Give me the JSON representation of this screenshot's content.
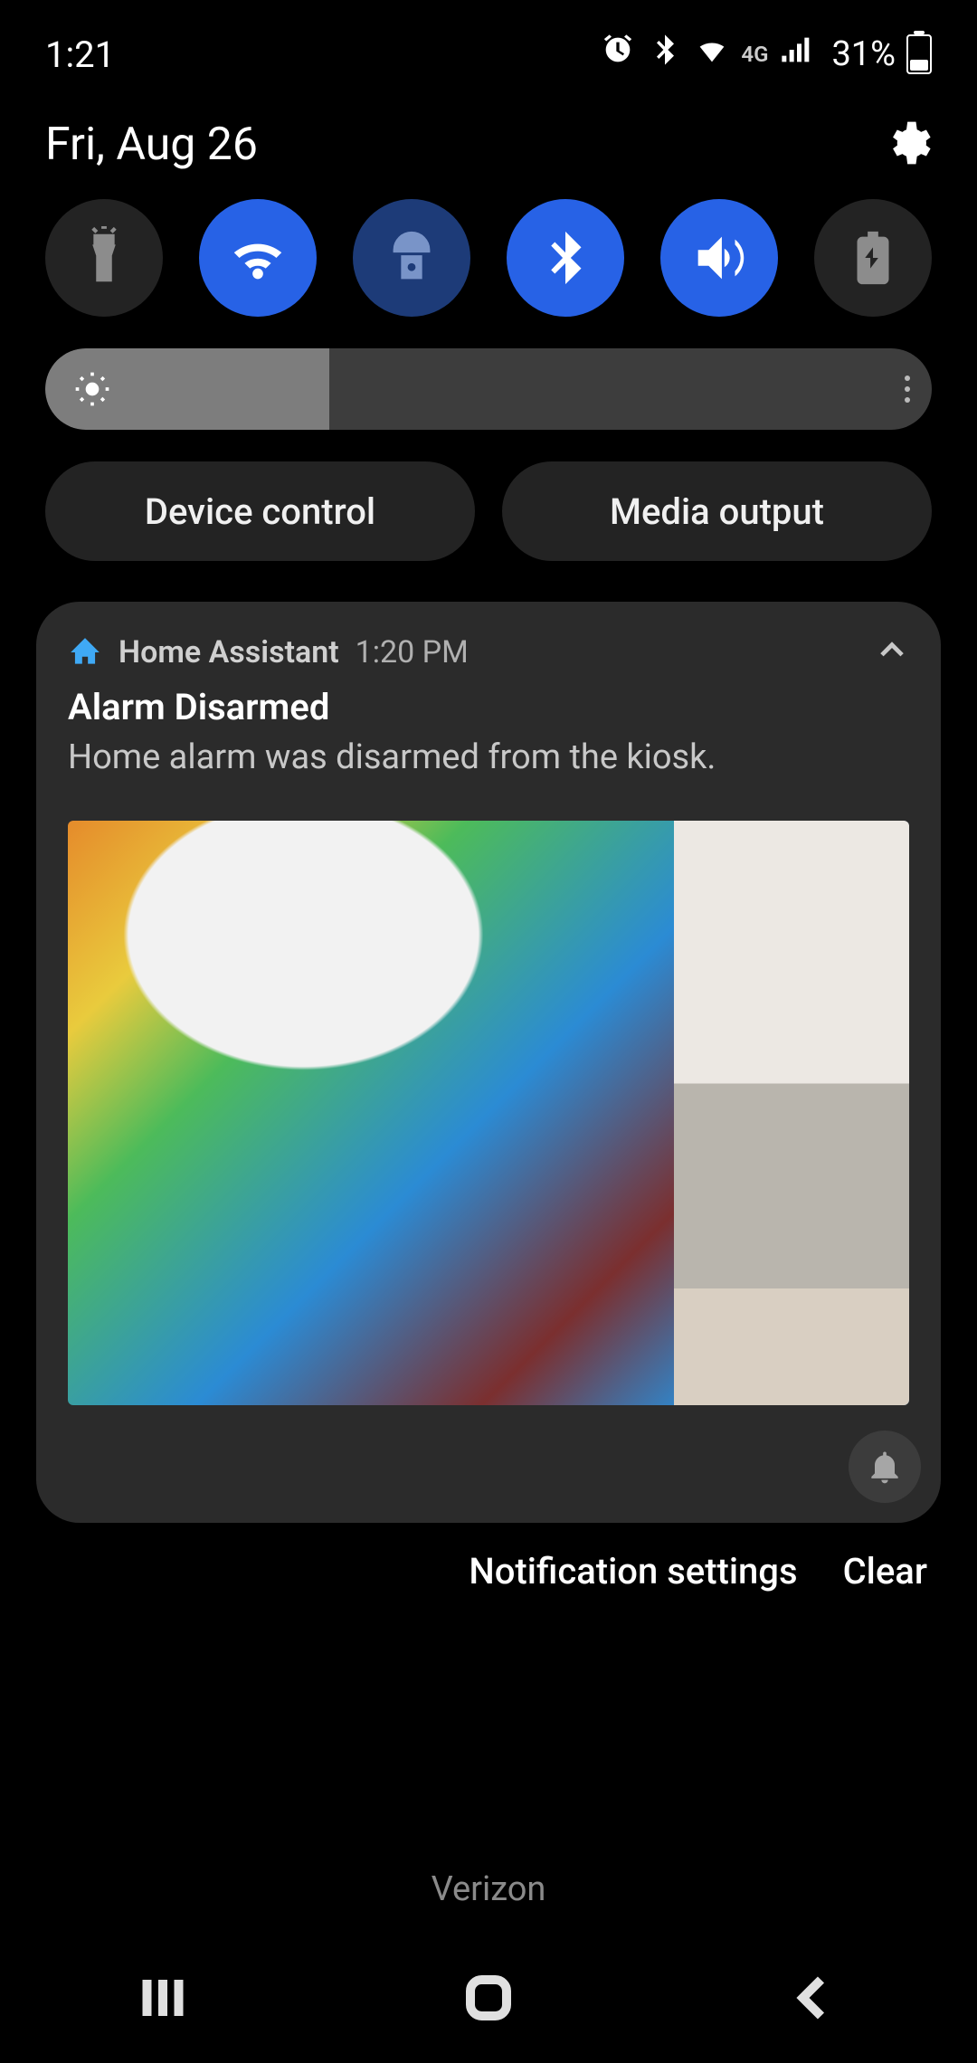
{
  "status": {
    "time": "1:21",
    "icons": [
      "alarm-icon",
      "bluetooth-icon",
      "wifi-icon",
      "4g-icon",
      "signal-icon"
    ],
    "battery_pct": "31%"
  },
  "date_row": {
    "date": "Fri, Aug 26"
  },
  "quick_toggles": [
    {
      "name": "flashlight-toggle",
      "icon": "flashlight-icon",
      "state": "off"
    },
    {
      "name": "wifi-toggle",
      "icon": "wifi-icon",
      "state": "on"
    },
    {
      "name": "app-lock-toggle",
      "icon": "android-lock-icon",
      "state": "special"
    },
    {
      "name": "bluetooth-toggle",
      "icon": "bluetooth-icon",
      "state": "on"
    },
    {
      "name": "sound-toggle",
      "icon": "speaker-icon",
      "state": "on"
    },
    {
      "name": "power-save-toggle",
      "icon": "battery-recycle-icon",
      "state": "off"
    }
  ],
  "brightness": {
    "percent": 32
  },
  "pills": {
    "device_control": "Device control",
    "media_output": "Media output"
  },
  "notification": {
    "app_name": "Home Assistant",
    "time": "1:20 PM",
    "title": "Alarm Disarmed",
    "body": "Home alarm was disarmed from the kiosk.",
    "has_image": true
  },
  "footer": {
    "notification_settings": "Notification settings",
    "clear": "Clear"
  },
  "carrier": "Verizon"
}
